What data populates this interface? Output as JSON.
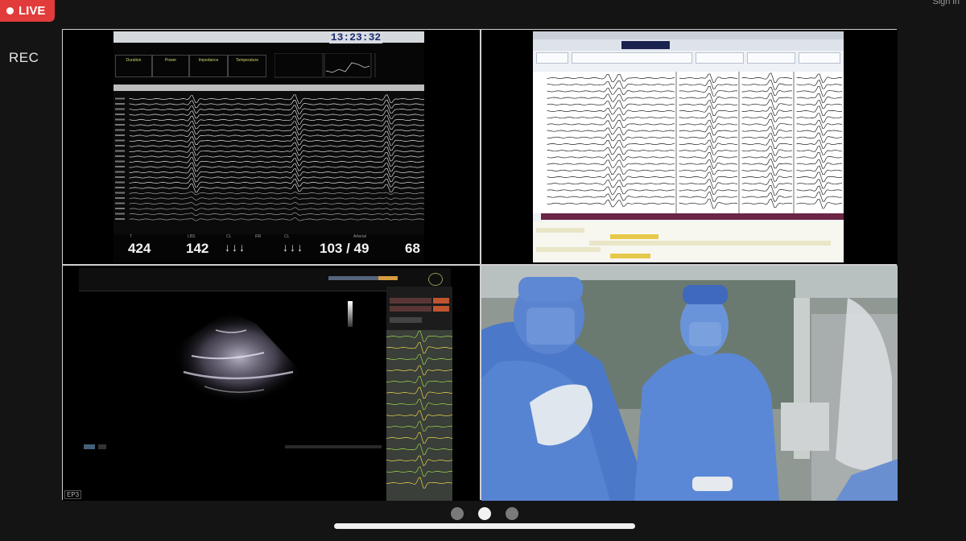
{
  "header": {
    "live_label": "LIVE",
    "rec_label": "REC",
    "sign_in_label": "Sign in"
  },
  "ep_system": {
    "clock": "13:23:32",
    "panel_labels": [
      "Duration",
      "Power",
      "Impedance",
      "Temperature"
    ],
    "bottom_values": {
      "v1": "424",
      "v2": "142",
      "arrows_a": "↓↓↓",
      "arrows_b": "↓↓↓",
      "bp": "103 / 49",
      "v4": "68"
    },
    "bottom_tiny": [
      "T",
      "LBS",
      "CL",
      "CL",
      "RR",
      "Arterial"
    ]
  },
  "echo": {
    "tag": "EP3"
  },
  "pagination": {
    "count": 3,
    "active_index": 1
  },
  "colors": {
    "live_red": "#e23b3b",
    "clock_blue": "#1a2d6e",
    "ecg_green": "#9bd44a",
    "ecg_yellow": "#e6d44a"
  }
}
